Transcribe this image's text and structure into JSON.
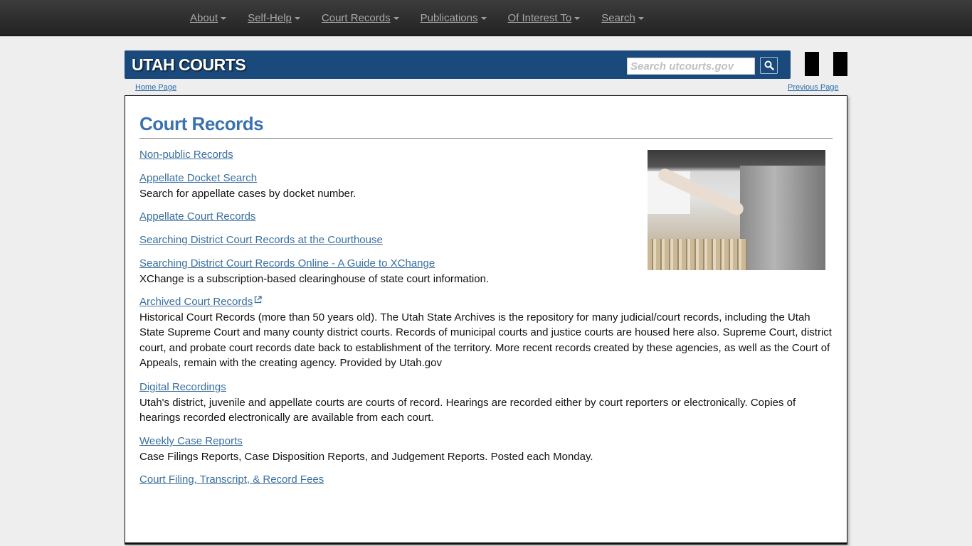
{
  "nav": {
    "items": [
      {
        "label": "About"
      },
      {
        "label": "Self-Help"
      },
      {
        "label": "Court Records"
      },
      {
        "label": "Publications"
      },
      {
        "label": "Of Interest To"
      },
      {
        "label": "Search"
      }
    ]
  },
  "header": {
    "site_title": "UTAH COURTS",
    "search_placeholder": "Search utcourts.gov",
    "search_icon": "search-icon"
  },
  "breadcrumbs": {
    "home": "Home Page",
    "previous": "Previous Page"
  },
  "main": {
    "title": "Court Records",
    "image_alt": "Person filing records in a metal cabinet drawer",
    "entries": [
      {
        "link": "Non-public Records",
        "desc": ""
      },
      {
        "link": "Appellate Docket Search",
        "desc": "Search for appellate cases by docket number."
      },
      {
        "link": "Appellate Court Records",
        "desc": ""
      },
      {
        "link": "Searching District Court Records at the Courthouse",
        "desc": ""
      },
      {
        "link": "Searching District Court Records Online - A Guide to XChange",
        "desc": "XChange is a subscription-based clearinghouse of state court information."
      },
      {
        "link": "Archived Court Records",
        "external": true,
        "desc": "Historical Court Records (more than 50 years old). The Utah State Archives is the repository for many judicial/court records, including the Utah State Supreme Court and many county district courts. Records of municipal courts and justice courts are housed here also. Supreme Court, district court, and probate court records date back to establishment of the territory. More recent records created by these agencies, as well as the Court of Appeals, remain with the creating agency. Provided by Utah.gov"
      },
      {
        "link": "Digital Recordings",
        "desc": "Utah's district, juvenile and appellate courts are courts of record. Hearings are recorded either by court reporters or electronically. Copies of hearings recorded electronically are available from each court."
      },
      {
        "link": "Weekly Case Reports",
        "desc": "Case Filings Reports, Case Disposition Reports, and Judgement Reports. Posted each Monday."
      },
      {
        "link": "Court Filing, Transcript, & Record Fees",
        "desc": ""
      }
    ]
  },
  "colors": {
    "banner": "#1a4a7c",
    "heading": "#3a72ae",
    "link": "#3a6f9f"
  }
}
